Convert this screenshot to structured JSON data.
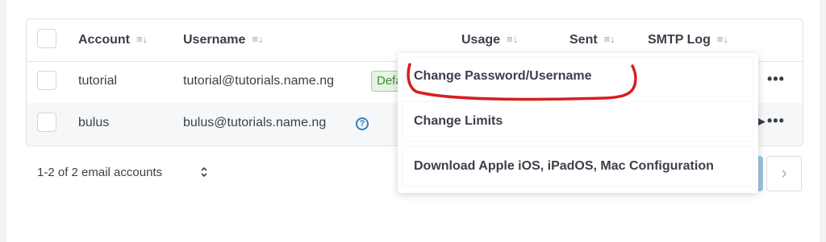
{
  "table": {
    "headers": {
      "account": "Account",
      "username": "Username",
      "usage": "Usage",
      "sent": "Sent",
      "smtp_log": "SMTP Log"
    },
    "rows": [
      {
        "account": "tutorial",
        "username": "tutorial@tutorials.name.ng",
        "badge": "Default"
      },
      {
        "account": "bulus",
        "username": "bulus@tutorials.name.ng",
        "help": "?"
      }
    ],
    "more_label": "•••",
    "sort_icon": "sort-icon"
  },
  "footer": {
    "count_text": "1-2 of 2 email accounts",
    "updown": "⌃⌄",
    "next_label": "›"
  },
  "menu": {
    "items": [
      "Change Password/Username",
      "Change Limits",
      "Download Apple iOS, iPadOS, Mac Configuration"
    ]
  },
  "colors": {
    "annotation": "#d61f1f",
    "badge_bg": "#e6f4e3",
    "badge_text": "#3c8a2e",
    "help": "#2f7ec0",
    "pagination_active": "#9cc6dd"
  }
}
